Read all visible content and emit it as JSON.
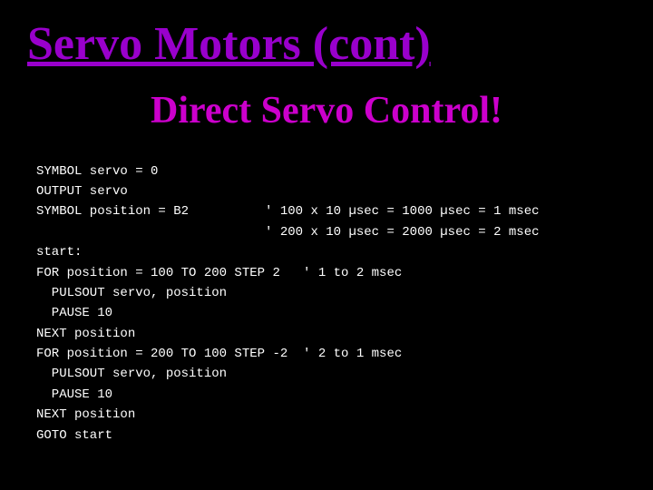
{
  "page": {
    "background": "#000000"
  },
  "header": {
    "main_title": "Servo Motors (cont)",
    "subtitle": "Direct Servo Control!"
  },
  "code": {
    "lines": [
      "SYMBOL servo = 0",
      "OUTPUT servo",
      "SYMBOL position = B2          ' 100 x 10 µsec = 1000 µsec = 1 msec",
      "                              ' 200 x 10 µsec = 2000 µsec = 2 msec",
      "",
      "start:",
      "FOR position = 100 TO 200 STEP 2   ' 1 to 2 msec",
      "  PULSOUT servo, position",
      "  PAUSE 10",
      "NEXT position",
      "FOR position = 200 TO 100 STEP -2  ' 2 to 1 msec",
      "  PULSOUT servo, position",
      "  PAUSE 10",
      "NEXT position",
      "GOTO start"
    ]
  }
}
